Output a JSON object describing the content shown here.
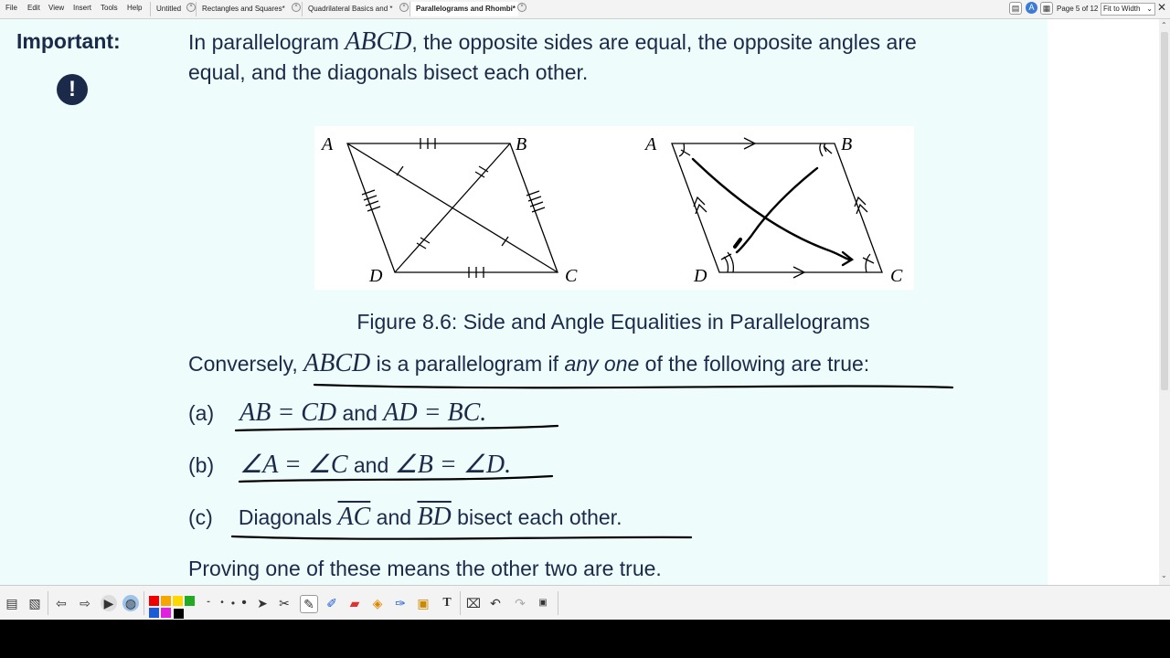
{
  "menu": [
    "File",
    "Edit",
    "View",
    "Insert",
    "Tools",
    "Help"
  ],
  "tabs": [
    {
      "label": "Untitled",
      "active": false
    },
    {
      "label": "Rectangles and Squares*",
      "active": false
    },
    {
      "label": "Quadrilateral Basics and *",
      "active": false
    },
    {
      "label": "Parallelograms and Rhombi*",
      "active": true
    }
  ],
  "page_indicator": "Page 5 of 12",
  "zoom": "Fit to Width",
  "note": {
    "label": "Important:",
    "icon": "exclamation-icon",
    "line1_prefix": "In parallelogram ",
    "line1_math": "ABCD",
    "line1_suffix": ", the opposite sides are equal, the opposite angles are",
    "line2": "equal, and the diagonals bisect each other."
  },
  "figure": {
    "caption": "Figure 8.6: Side and Angle Equalities in Parallelograms",
    "labels": {
      "a": "A",
      "b": "B",
      "c": "C",
      "d": "D"
    }
  },
  "conversely": {
    "prefix": "Conversely, ",
    "math": "ABCD",
    "mid": " is a parallelogram if ",
    "em": "any one",
    "suffix": " of the following are true:"
  },
  "conditions": [
    {
      "tag": "(a)",
      "math1": "AB = CD",
      "word": " and ",
      "math2": "AD = BC",
      "end": "."
    },
    {
      "tag": "(b)",
      "math1": "∠A = ∠C",
      "word": " and ",
      "math2": "∠B = ∠D",
      "end": "."
    },
    {
      "tag": "(c)",
      "pre": "Diagonals ",
      "seg1": "AC",
      "word": " and ",
      "seg2": "BD",
      "post": " bisect each other."
    }
  ],
  "closing": "Proving one of these means the other two are true.",
  "ink_color": "#000000",
  "accent": "#1b2a4a"
}
